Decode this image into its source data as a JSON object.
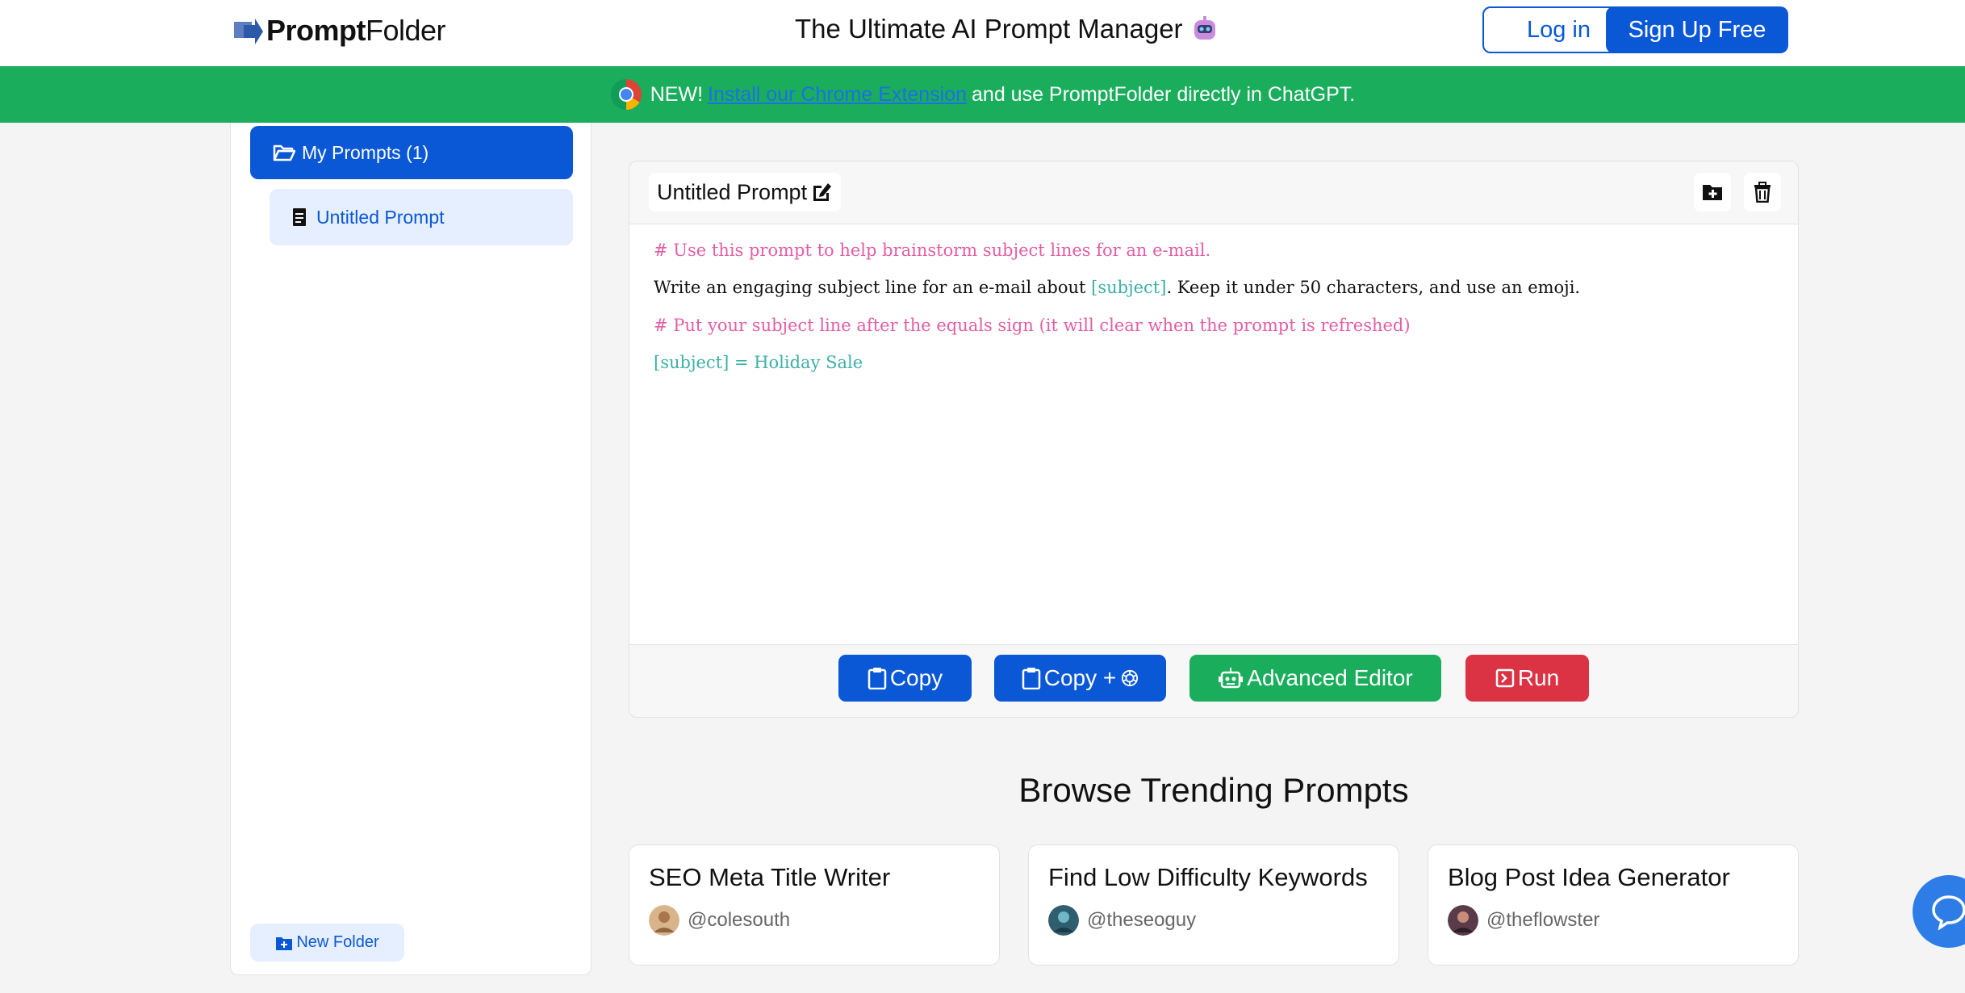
{
  "header": {
    "logo_bold": "Prompt",
    "logo_thin": "Folder",
    "tagline": "The Ultimate AI Prompt Manager",
    "login_label": "Log in",
    "signup_label": "Sign Up Free"
  },
  "banner": {
    "new_label": "NEW!",
    "link_text": "Install our Chrome Extension",
    "rest_text": "and use PromptFolder directly in ChatGPT."
  },
  "sidebar": {
    "folder_label": "My Prompts (1)",
    "items": [
      {
        "label": "Untitled Prompt"
      }
    ],
    "new_folder_label": "New Folder"
  },
  "editor": {
    "title": "Untitled Prompt",
    "lines": {
      "l1": "# Use this prompt to help brainstorm subject lines for an e-mail.",
      "l2_a": "Write an engaging subject line for an e-mail about ",
      "l2_var": "[subject]",
      "l2_b": ". Keep it under 50 characters, and use an emoji.",
      "l3": "# Put your subject line after the equals sign (it will clear when the prompt is refreshed)",
      "l4": "[subject] = Holiday Sale"
    },
    "actions": {
      "copy": "Copy",
      "copy_plus": "Copy +",
      "advanced": "Advanced Editor",
      "run": "Run"
    }
  },
  "trending": {
    "title": "Browse Trending Prompts",
    "cards": [
      {
        "title": "SEO Meta Title Writer",
        "user": "@colesouth"
      },
      {
        "title": "Find Low Difficulty Keywords",
        "user": "@theseoguy"
      },
      {
        "title": "Blog Post Idea Generator",
        "user": "@theflowster"
      }
    ]
  },
  "colors": {
    "primary": "#0a58d6",
    "banner_green": "#1aae5c",
    "run_red": "#dc3344",
    "comment_pink": "#e35ea5",
    "variable_teal": "#3cb0a6"
  }
}
